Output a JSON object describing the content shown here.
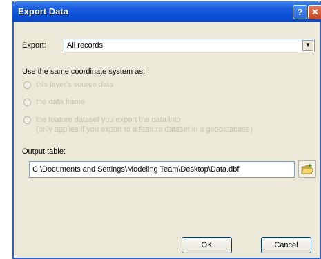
{
  "window": {
    "title": "Export Data"
  },
  "export": {
    "label": "Export:",
    "selected": "All records"
  },
  "coords": {
    "heading": "Use the same coordinate system as:",
    "options": [
      {
        "label": "this layer's source data"
      },
      {
        "label": "the data frame"
      },
      {
        "label": "the feature dataset you export the data into",
        "sub": "(only applies if you export to a feature dataset in a geodatabase)"
      }
    ]
  },
  "output": {
    "label": "Output table:",
    "path": "C:\\Documents and Settings\\Modeling Team\\Desktop\\Data.dbf"
  },
  "buttons": {
    "ok": "OK",
    "cancel": "Cancel"
  },
  "icons": {
    "help": "help-icon",
    "close": "close-icon",
    "folder": "open-folder-icon",
    "dropdown": "chevron-down-icon"
  }
}
